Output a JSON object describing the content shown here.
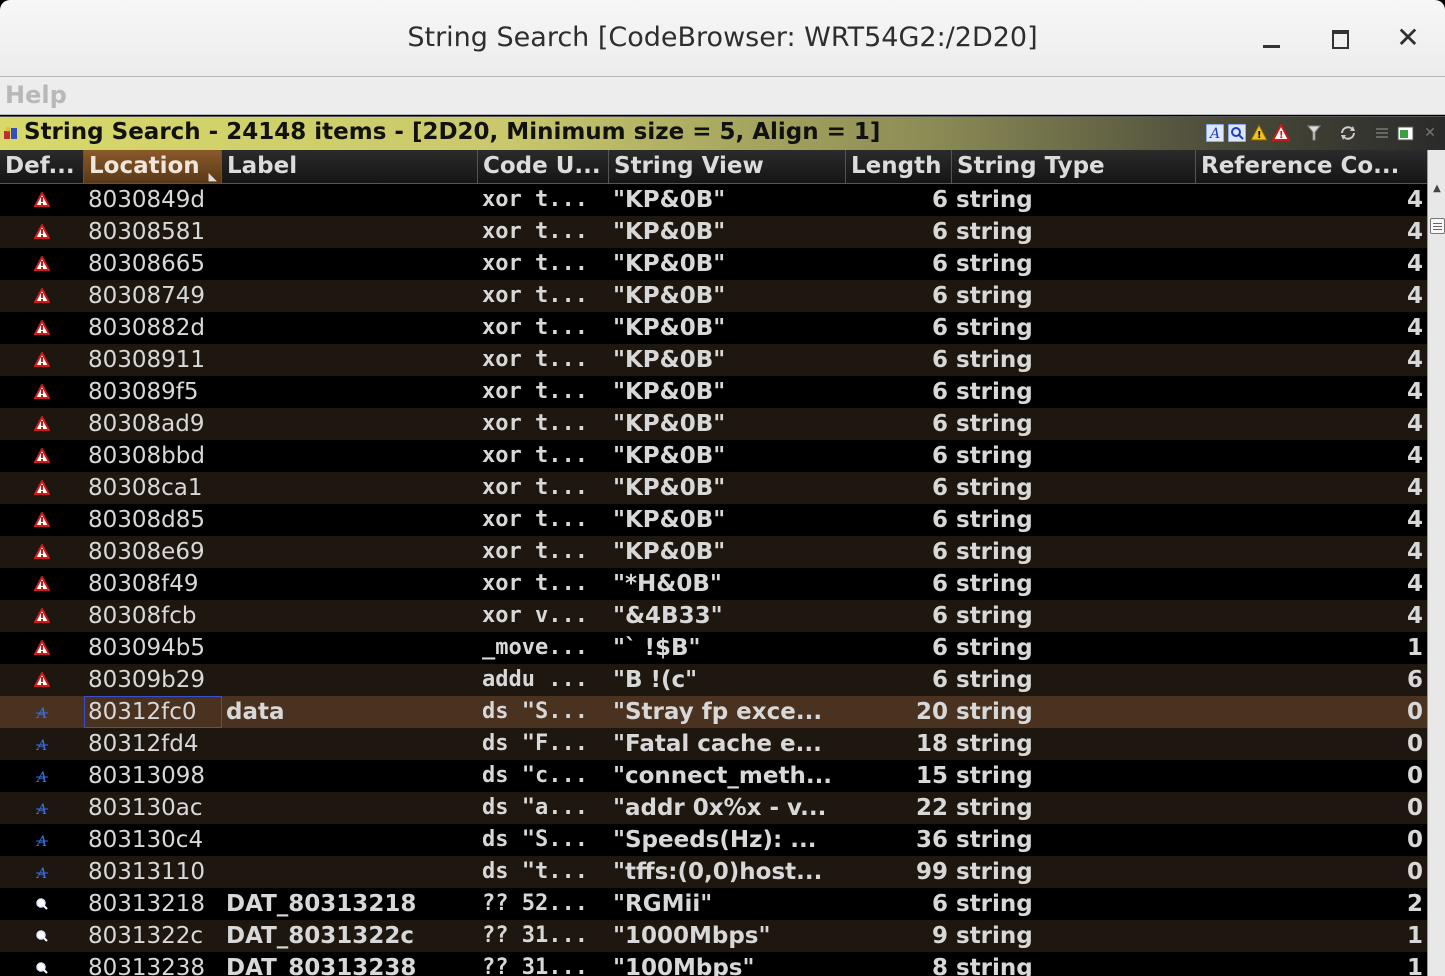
{
  "window": {
    "title": "String Search [CodeBrowser: WRT54G2:/2D20]"
  },
  "menu": {
    "help": "Help"
  },
  "provider": {
    "title": "String Search - 24148 items - [2D20, Minimum size = 5, Align = 1]"
  },
  "columns": [
    "Def...",
    "Location",
    "Label",
    "Code U...",
    "String View",
    "Length",
    "String Type",
    "Reference Co..."
  ],
  "rows": [
    {
      "icon": "warning",
      "location": "8030849d",
      "label": "",
      "code": "xor t...",
      "view": "\"KP&0B\"",
      "length": "6",
      "type": "string",
      "refs": "4"
    },
    {
      "icon": "warning",
      "location": "80308581",
      "label": "",
      "code": "xor t...",
      "view": "\"KP&0B\"",
      "length": "6",
      "type": "string",
      "refs": "4"
    },
    {
      "icon": "warning",
      "location": "80308665",
      "label": "",
      "code": "xor t...",
      "view": "\"KP&0B\"",
      "length": "6",
      "type": "string",
      "refs": "4"
    },
    {
      "icon": "warning",
      "location": "80308749",
      "label": "",
      "code": "xor t...",
      "view": "\"KP&0B\"",
      "length": "6",
      "type": "string",
      "refs": "4"
    },
    {
      "icon": "warning",
      "location": "8030882d",
      "label": "",
      "code": "xor t...",
      "view": "\"KP&0B\"",
      "length": "6",
      "type": "string",
      "refs": "4"
    },
    {
      "icon": "warning",
      "location": "80308911",
      "label": "",
      "code": "xor t...",
      "view": "\"KP&0B\"",
      "length": "6",
      "type": "string",
      "refs": "4"
    },
    {
      "icon": "warning",
      "location": "803089f5",
      "label": "",
      "code": "xor t...",
      "view": "\"KP&0B\"",
      "length": "6",
      "type": "string",
      "refs": "4"
    },
    {
      "icon": "warning",
      "location": "80308ad9",
      "label": "",
      "code": "xor t...",
      "view": "\"KP&0B\"",
      "length": "6",
      "type": "string",
      "refs": "4"
    },
    {
      "icon": "warning",
      "location": "80308bbd",
      "label": "",
      "code": "xor t...",
      "view": "\"KP&0B\"",
      "length": "6",
      "type": "string",
      "refs": "4"
    },
    {
      "icon": "warning",
      "location": "80308ca1",
      "label": "",
      "code": "xor t...",
      "view": "\"KP&0B\"",
      "length": "6",
      "type": "string",
      "refs": "4"
    },
    {
      "icon": "warning",
      "location": "80308d85",
      "label": "",
      "code": "xor t...",
      "view": "\"KP&0B\"",
      "length": "6",
      "type": "string",
      "refs": "4"
    },
    {
      "icon": "warning",
      "location": "80308e69",
      "label": "",
      "code": "xor t...",
      "view": "\"KP&0B\"",
      "length": "6",
      "type": "string",
      "refs": "4"
    },
    {
      "icon": "warning",
      "location": "80308f49",
      "label": "",
      "code": "xor t...",
      "view": "\"*H&0B\"",
      "length": "6",
      "type": "string",
      "refs": "4"
    },
    {
      "icon": "warning",
      "location": "80308fcb",
      "label": "",
      "code": "xor v...",
      "view": "\"&4B33\"",
      "length": "6",
      "type": "string",
      "refs": "4"
    },
    {
      "icon": "warning",
      "location": "803094b5",
      "label": "",
      "code": "_move...",
      "view": "\"` !$B\"",
      "length": "6",
      "type": "string",
      "refs": "1"
    },
    {
      "icon": "warning",
      "location": "80309b29",
      "label": "",
      "code": "addu ...",
      "view": "\"B !(c\"",
      "length": "6",
      "type": "string",
      "refs": "6"
    },
    {
      "icon": "defined",
      "location": "80312fc0",
      "label": "data",
      "code": "ds \"S...",
      "view": "\"Stray fp exce...",
      "length": "20",
      "type": "string",
      "refs": "0",
      "selected": true
    },
    {
      "icon": "defined",
      "location": "80312fd4",
      "label": "",
      "code": "ds \"F...",
      "view": "\"Fatal cache e...",
      "length": "18",
      "type": "string",
      "refs": "0"
    },
    {
      "icon": "defined",
      "location": "80313098",
      "label": "",
      "code": "ds \"c...",
      "view": "\"connect_meth...",
      "length": "15",
      "type": "string",
      "refs": "0"
    },
    {
      "icon": "defined",
      "location": "803130ac",
      "label": "",
      "code": "ds \"a...",
      "view": "\"addr 0x%x - v...",
      "length": "22",
      "type": "string",
      "refs": "0"
    },
    {
      "icon": "defined",
      "location": "803130c4",
      "label": "",
      "code": "ds \"S...",
      "view": "\"Speeds(Hz): ...",
      "length": "36",
      "type": "string",
      "refs": "0"
    },
    {
      "icon": "defined",
      "location": "80313110",
      "label": "",
      "code": "ds \"t...",
      "view": "\"tffs:(0,0)host...",
      "length": "99",
      "type": "string",
      "refs": "0"
    },
    {
      "icon": "undefined",
      "location": "80313218",
      "label": "DAT_80313218",
      "code": "?? 52...",
      "view": "\"RGMii\"",
      "length": "6",
      "type": "string",
      "refs": "2"
    },
    {
      "icon": "undefined",
      "location": "8031322c",
      "label": "DAT_8031322c",
      "code": "?? 31...",
      "view": "\"1000Mbps\"",
      "length": "9",
      "type": "string",
      "refs": "1"
    },
    {
      "icon": "undefined",
      "location": "80313238",
      "label": "DAT_80313238",
      "code": "?? 31...",
      "view": "\"100Mbps\"",
      "length": "8",
      "type": "string",
      "refs": "1"
    }
  ],
  "colors": {
    "accent_sorted_column": "#8a5a2a",
    "selected_row": "#4a3220",
    "warning_red": "#d01818",
    "defined_blue": "#3a6fe0"
  }
}
